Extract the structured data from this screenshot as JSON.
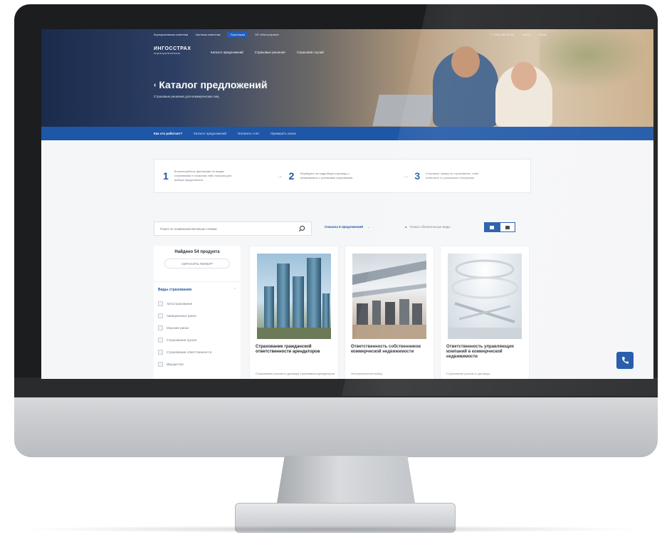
{
  "topbar": {
    "links": [
      "Корпоративным клиентам",
      "Частным клиентам",
      "Партнерам",
      "Об «Ингосстрахе»"
    ],
    "phone": "+7 (495) 956-55-55",
    "login": "Войти",
    "menu": "Меню"
  },
  "logo": {
    "name": "ИНГОССТРАХ",
    "tagline": "корпоративным"
  },
  "main_nav": [
    "Каталог предложений",
    "Страховые решения",
    "Страховой случай"
  ],
  "hero": {
    "title": "Каталог предложений",
    "subtitle": "Страховые решения для коммерческих лиц"
  },
  "blue_nav": [
    "Как это работает?",
    "Каталог предложений",
    "Оплатить счёт",
    "Проверить полис"
  ],
  "steps": [
    {
      "num": "1",
      "text": "Воспользуйтесь фильтрами по видам страхования и отраслям либо поиском для выбора предложения"
    },
    {
      "num": "2",
      "text": "Перейдите на подробную страницу и ознакомьтесь с условиями страхования"
    },
    {
      "num": "3",
      "text": "Отправьте заявку на страхование, либо позвоните по указанным телефонам"
    }
  ],
  "toolbar": {
    "search_placeholder": "Поиск по названию/ключевым словам",
    "sort_label": "Сначала 5 предложений",
    "only_label": "Только обязательные виды"
  },
  "sidebar": {
    "found": "Найдено 54 продукта",
    "reset": "СБРОСИТЬ ФИЛЬТР",
    "filter_title": "Виды страхования",
    "filters": [
      "Автострахование",
      "Авиационные риски",
      "Морские риски",
      "Страхование грузов",
      "Страхование ответственности",
      "Имущество"
    ]
  },
  "cards": [
    {
      "title": "Страхование гражданской ответственности арендаторов",
      "bullet": "Страхование рисков по договору страхования арендаторов"
    },
    {
      "title": "Ответственность собственников коммерческой недвижимости",
      "bullet": "Неограниченный выбор"
    },
    {
      "title": "Ответственность управляющих компаний в коммерческой недвижимости",
      "bullet": "Страхование рисков по договору"
    }
  ],
  "colors": {
    "primary_blue": "#1e56a8",
    "bezel": "#1c1d1f"
  }
}
